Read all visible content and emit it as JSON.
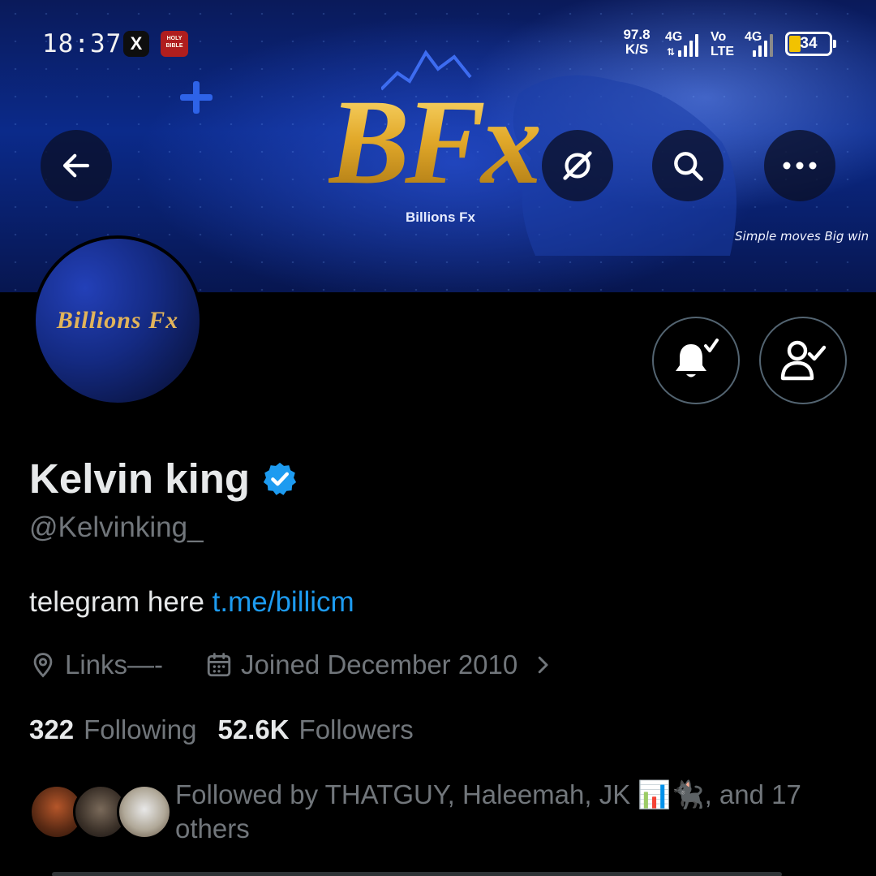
{
  "status_bar": {
    "time": "18:37",
    "x_app_icon": "X",
    "bible_app_label": "HOLY BIBLE",
    "net_speed_value": "97.8",
    "net_speed_unit": "K/S",
    "sim1_label": "4G",
    "volte_top": "Vo",
    "volte_bottom": "LTE",
    "sim2_label": "4G",
    "battery_level": "34"
  },
  "banner": {
    "logo_text": "BFx",
    "logo_subtitle": "Billions Fx",
    "tagline": "Simple moves Big win"
  },
  "header": {
    "back_icon": "arrow-left-icon",
    "grok_icon": "grok-icon",
    "search_icon": "search-icon",
    "more_icon": "more-icon"
  },
  "avatar": {
    "text": "Billions Fx"
  },
  "actions": {
    "notifications_icon": "bell-check-icon",
    "following_icon": "person-check-icon"
  },
  "profile": {
    "display_name": "Kelvin king",
    "verified": true,
    "handle": "@Kelvinking_",
    "bio_text": "telegram here ",
    "bio_link": "t.me/billicm",
    "location": "Links—-",
    "joined": "Joined December 2010",
    "following_count": "322",
    "following_label": "Following",
    "followers_count": "52.6K",
    "followers_label": "Followers",
    "followed_by": "Followed by THATGUY, Haleemah, JK 📊🐈‍⬛, and 17 others"
  },
  "colors": {
    "accent": "#1d9bf0",
    "muted_text": "#71767b",
    "primary_text": "#e7e9ea",
    "background": "#000000"
  }
}
